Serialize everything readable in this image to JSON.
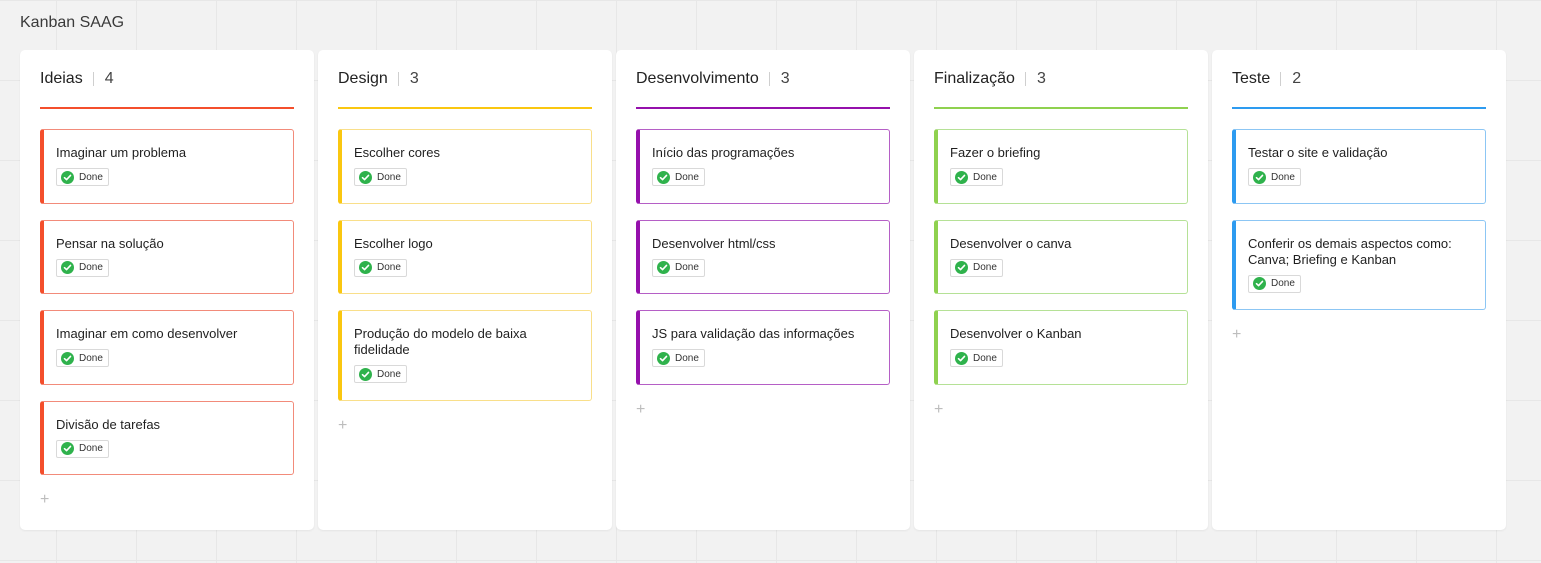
{
  "board": {
    "title": "Kanban SAAG"
  },
  "columns": [
    {
      "title": "Ideias",
      "count": "4",
      "color": "#f44f2c",
      "border": "#f28b7a",
      "cards": [
        {
          "title": "Imaginar um problema",
          "tag": "Done"
        },
        {
          "title": "Pensar na solução",
          "tag": "Done"
        },
        {
          "title": "Imaginar em como desenvolver",
          "tag": "Done"
        },
        {
          "title": "Divisão de tarefas",
          "tag": "Done"
        }
      ]
    },
    {
      "title": "Design",
      "count": "3",
      "color": "#fac710",
      "border": "#f9df8a",
      "cards": [
        {
          "title": "Escolher cores",
          "tag": "Done"
        },
        {
          "title": "Escolher logo",
          "tag": "Done"
        },
        {
          "title": "Produção do modelo de baixa fidelidade",
          "tag": "Done"
        }
      ]
    },
    {
      "title": "Desenvolvimento",
      "count": "3",
      "color": "#9510ac",
      "border": "#b55fc6",
      "cards": [
        {
          "title": "Início das programações",
          "tag": "Done"
        },
        {
          "title": "Desenvolver html/css",
          "tag": "Done"
        },
        {
          "title": "JS para validação das informações",
          "tag": "Done"
        }
      ]
    },
    {
      "title": "Finalização",
      "count": "3",
      "color": "#8fd14f",
      "border": "#b5e196",
      "cards": [
        {
          "title": "Fazer o briefing",
          "tag": "Done"
        },
        {
          "title": "Desenvolver o canva",
          "tag": "Done"
        },
        {
          "title": "Desenvolver o Kanban",
          "tag": "Done"
        }
      ]
    },
    {
      "title": "Teste",
      "count": "2",
      "color": "#2d9bf0",
      "border": "#8cc6f4",
      "cards": [
        {
          "title": "Testar o site e validação",
          "tag": "Done"
        },
        {
          "title": "Conferir os demais aspectos como: Canva; Briefing e Kanban",
          "tag": "Done"
        }
      ]
    }
  ],
  "add_card": {
    "symbol": "+"
  },
  "icons": {
    "tag_icon": "check-circle-icon",
    "add_icon": "plus-icon"
  }
}
